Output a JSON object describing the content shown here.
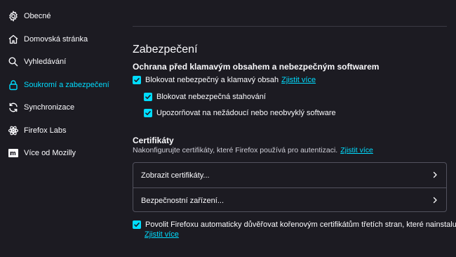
{
  "sidebar": {
    "items": [
      {
        "label": "Obecné",
        "icon": "gear-icon",
        "selected": false
      },
      {
        "label": "Domovská stránka",
        "icon": "home-icon",
        "selected": false
      },
      {
        "label": "Vyhledávání",
        "icon": "search-icon",
        "selected": false
      },
      {
        "label": "Soukromí a zabezpečení",
        "icon": "lock-icon",
        "selected": true
      },
      {
        "label": "Synchronizace",
        "icon": "sync-icon",
        "selected": false
      },
      {
        "label": "Firefox Labs",
        "icon": "labs-icon",
        "selected": false
      },
      {
        "label": "Více od Mozilly",
        "icon": "mozilla-m-icon",
        "selected": false
      }
    ]
  },
  "security": {
    "title": "Zabezpečení",
    "subtitle": "Ochrana před klamavým obsahem a nebezpečným softwarem",
    "block_dangerous": {
      "label": "Blokovat nebezpečný a klamavý obsah",
      "link": "Zjistit více",
      "checked": true
    },
    "block_downloads": {
      "label": "Blokovat nebezpečná stahování",
      "checked": true
    },
    "warn_unwanted": {
      "label": "Upozorňovat na nežádoucí nebo neobvyklý software",
      "checked": true
    }
  },
  "certificates": {
    "title": "Certifikáty",
    "description": "Nakonfigurujte certifikáty, které Firefox používá pro autentizaci.",
    "link": "Zjistit více",
    "view_button": "Zobrazit certifikáty...",
    "devices_button": "Bezpečnostní zařízení...",
    "auto_trust": {
      "label": "Povolit Firefoxu automaticky důvěřovat kořenovým certifikátům třetích stran, které nainstalujete",
      "link": "Zjistit více",
      "checked": true
    }
  },
  "colors": {
    "accent": "#00ddff",
    "background": "#1c1b22",
    "text": "#fbfbfe"
  }
}
